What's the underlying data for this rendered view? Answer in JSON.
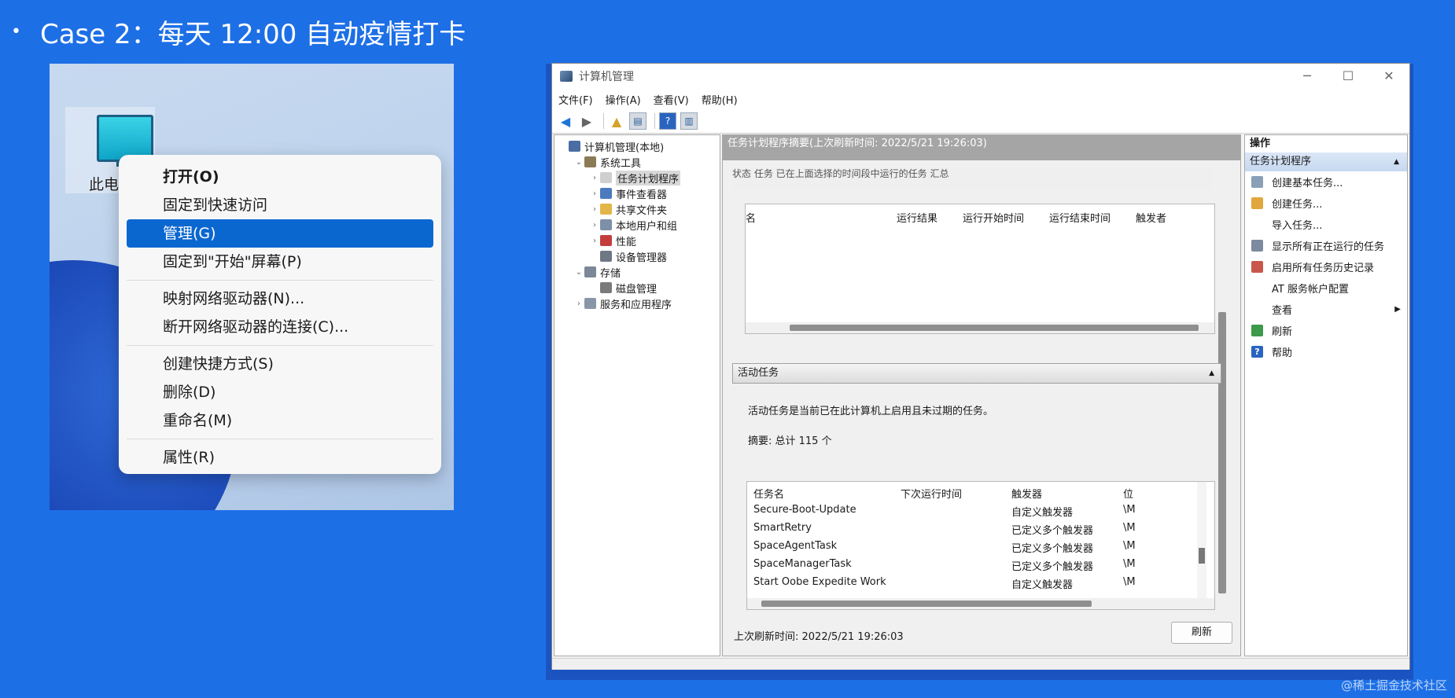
{
  "slide": {
    "bullet": "•",
    "title": "Case 2：每天 12:00 自动疫情打卡",
    "watermark": "@稀土掘金技术社区"
  },
  "desktop": {
    "icon_label": "此电",
    "context_menu": [
      {
        "label": "打开(O)",
        "bold": true
      },
      {
        "label": "固定到快速访问"
      },
      {
        "label": "管理(G)",
        "selected": true
      },
      {
        "label": "固定到\"开始\"屏幕(P)"
      },
      {
        "sep": true
      },
      {
        "label": "映射网络驱动器(N)..."
      },
      {
        "label": "断开网络驱动器的连接(C)..."
      },
      {
        "sep": true
      },
      {
        "label": "创建快捷方式(S)"
      },
      {
        "label": "删除(D)"
      },
      {
        "label": "重命名(M)"
      },
      {
        "sep": true
      },
      {
        "label": "属性(R)"
      }
    ]
  },
  "window": {
    "title": "计算机管理",
    "controls": {
      "minimize": "─",
      "maximize": "☐",
      "close": "✕"
    },
    "menu": [
      "文件(F)",
      "操作(A)",
      "查看(V)",
      "帮助(H)"
    ],
    "tree": [
      {
        "label": "计算机管理(本地)",
        "level": 0,
        "toggle": "",
        "icon_color": "#4a6ea3"
      },
      {
        "label": "系统工具",
        "level": 1,
        "toggle": "⌄",
        "icon_color": "#8a7a56"
      },
      {
        "label": "任务计划程序",
        "level": 2,
        "toggle": "›",
        "icon_color": "#cfcfcf",
        "selected": true
      },
      {
        "label": "事件查看器",
        "level": 2,
        "toggle": "›",
        "icon_color": "#4b7abf"
      },
      {
        "label": "共享文件夹",
        "level": 2,
        "toggle": "›",
        "icon_color": "#e3b64a"
      },
      {
        "label": "本地用户和组",
        "level": 2,
        "toggle": "›",
        "icon_color": "#7e8fa8"
      },
      {
        "label": "性能",
        "level": 2,
        "toggle": "›",
        "icon_color": "#c43d3d"
      },
      {
        "label": "设备管理器",
        "level": 2,
        "toggle": "",
        "icon_color": "#6e7784"
      },
      {
        "label": "存储",
        "level": 1,
        "toggle": "⌄",
        "icon_color": "#7c8899"
      },
      {
        "label": "磁盘管理",
        "level": 2,
        "toggle": "",
        "icon_color": "#7a7a7a"
      },
      {
        "label": "服务和应用程序",
        "level": 1,
        "toggle": "›",
        "icon_color": "#8896a8"
      }
    ],
    "center": {
      "header": "任务计划程序摘要(上次刷新时间: 2022/5/21 19:26:03)",
      "cut_text": "状态 任务 已在上面选择的时间段中运行的任务 汇总",
      "top_table_headers": [
        "名",
        "运行结果",
        "运行开始时间",
        "运行结束时间",
        "触发者"
      ],
      "section_title": "活动任务",
      "section_desc": "活动任务是当前已在此计算机上启用且未过期的任务。",
      "summary": "摘要: 总计 115 个",
      "task_headers": [
        "任务名",
        "下次运行时间",
        "触发器",
        "位"
      ],
      "tasks": [
        {
          "name": "Secure-Boot-Update",
          "next": "",
          "trigger": "自定义触发器",
          "loc": "\\M"
        },
        {
          "name": "SmartRetry",
          "next": "",
          "trigger": "已定义多个触发器",
          "loc": "\\M"
        },
        {
          "name": "SpaceAgentTask",
          "next": "",
          "trigger": "已定义多个触发器",
          "loc": "\\M"
        },
        {
          "name": "SpaceManagerTask",
          "next": "",
          "trigger": "已定义多个触发器",
          "loc": "\\M"
        },
        {
          "name": "Start Oobe Expedite Work",
          "next": "",
          "trigger": "自定义触发器",
          "loc": "\\M"
        }
      ],
      "footer": "上次刷新时间: 2022/5/21 19:26:03",
      "refresh_button": "刷新"
    },
    "actions": {
      "header": "操作",
      "sub_header": "任务计划程序",
      "items": [
        {
          "label": "创建基本任务...",
          "icon_color": "#8aa0b8"
        },
        {
          "label": "创建任务...",
          "icon_color": "#e0a73c"
        },
        {
          "label": "导入任务...",
          "icon_color": ""
        },
        {
          "label": "显示所有正在运行的任务",
          "icon_color": "#7e8aa0"
        },
        {
          "label": "启用所有任务历史记录",
          "icon_color": "#c9564a"
        },
        {
          "label": "AT 服务帐户配置",
          "icon_color": ""
        },
        {
          "label": "查看",
          "icon_color": "",
          "submenu": true
        },
        {
          "label": "刷新",
          "icon_color": "#3c9a4a"
        },
        {
          "label": "帮助",
          "icon_color": "#2a64c0",
          "glyph": "?"
        }
      ]
    }
  },
  "colors": {
    "slide_bg": "#1d6fe6",
    "menu_selected": "#0b67d0",
    "center_header": "#a5a5a5"
  }
}
